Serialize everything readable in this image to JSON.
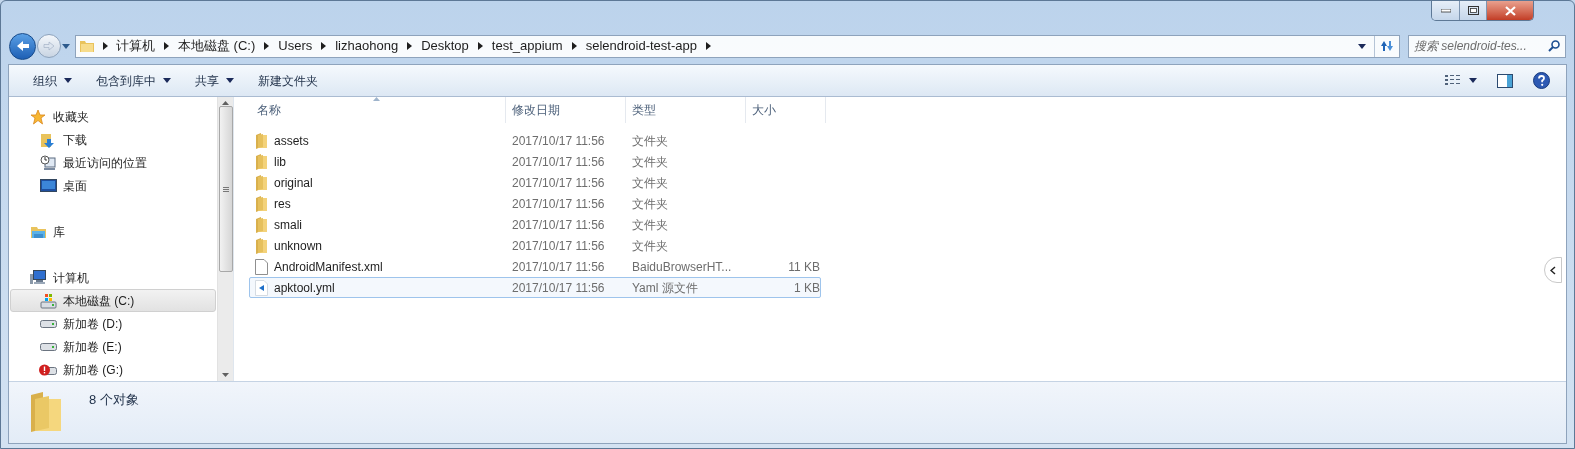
{
  "address_bar": {
    "crumbs": [
      "计算机",
      "本地磁盘 (C:)",
      "Users",
      "lizhaohong",
      "Desktop",
      "test_appium",
      "selendroid-test-app"
    ]
  },
  "search": {
    "placeholder": "搜索 selendroid-tes..."
  },
  "toolbar": [
    {
      "label": "组织",
      "dropdown": true
    },
    {
      "label": "包含到库中",
      "dropdown": true
    },
    {
      "label": "共享",
      "dropdown": true
    },
    {
      "label": "新建文件夹",
      "dropdown": false
    }
  ],
  "sidebar": {
    "items": [
      {
        "label": "收藏夹",
        "kind": "star",
        "selected": false,
        "children": [
          {
            "label": "下载",
            "kind": "download",
            "selected": false
          },
          {
            "label": "最近访问的位置",
            "kind": "recent",
            "selected": false
          },
          {
            "label": "桌面",
            "kind": "desktop",
            "selected": false
          }
        ]
      },
      {
        "label": "库",
        "kind": "library",
        "selected": false
      },
      {
        "label": "计算机",
        "kind": "computer",
        "selected": false,
        "children": [
          {
            "label": "本地磁盘 (C:)",
            "kind": "system-drive",
            "selected": true
          },
          {
            "label": "新加卷 (D:)",
            "kind": "drive",
            "selected": false
          },
          {
            "label": "新加卷 (E:)",
            "kind": "drive",
            "selected": false
          },
          {
            "label": "新加卷 (G:)",
            "kind": "error-drive",
            "selected": false
          }
        ]
      }
    ]
  },
  "table": {
    "columns": [
      "名称",
      "修改日期",
      "类型",
      "大小"
    ],
    "rows": [
      {
        "name": "assets",
        "kind": "folder",
        "modified": "2017/10/17 11:56",
        "type": "文件夹",
        "selected": false
      },
      {
        "name": "lib",
        "kind": "folder",
        "modified": "2017/10/17 11:56",
        "type": "文件夹",
        "selected": false
      },
      {
        "name": "original",
        "kind": "folder",
        "modified": "2017/10/17 11:56",
        "type": "文件夹",
        "selected": false
      },
      {
        "name": "res",
        "kind": "folder",
        "modified": "2017/10/17 11:56",
        "type": "文件夹",
        "selected": false
      },
      {
        "name": "smali",
        "kind": "folder",
        "modified": "2017/10/17 11:56",
        "type": "文件夹",
        "selected": false
      },
      {
        "name": "unknown",
        "kind": "folder",
        "modified": "2017/10/17 11:56",
        "type": "文件夹",
        "selected": false
      },
      {
        "name": "AndroidManifest.xml",
        "kind": "file",
        "modified": "2017/10/17 11:56",
        "type": "BaiduBrowserHT...",
        "size": "11 KB",
        "selected": false
      },
      {
        "name": "apktool.yml",
        "kind": "code-file",
        "modified": "2017/10/17 11:56",
        "type": "Yaml 源文件",
        "size": "1 KB",
        "selected": true
      }
    ]
  },
  "status_bar": {
    "text": "8 个对象"
  }
}
